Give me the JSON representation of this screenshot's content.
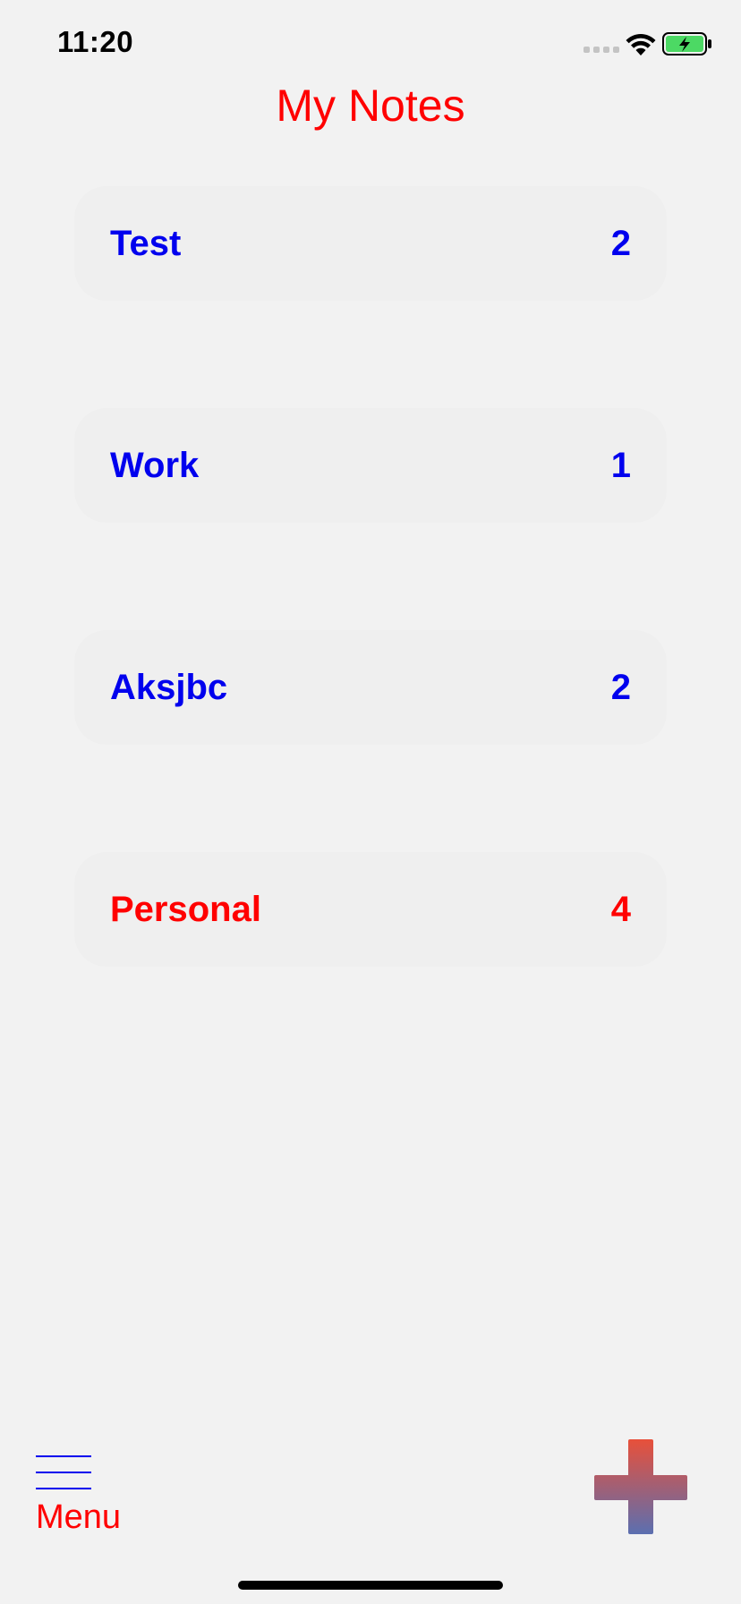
{
  "status_bar": {
    "time": "11:20",
    "icons": [
      "signal-icon",
      "wifi-icon",
      "battery-charging-icon"
    ]
  },
  "header": {
    "title": "My Notes"
  },
  "colors": {
    "title": "#ff0000",
    "item_default": "#0000ee",
    "item_selected": "#ff0000",
    "menu": "#ff0000",
    "card_background": "#efefef",
    "page_background": "#f2f2f2",
    "battery_green": "#4cd964",
    "add_gradient_top": "#e8503a",
    "add_gradient_bottom": "#5b6fb0"
  },
  "categories": [
    {
      "label": "Test",
      "count": "2",
      "selected": false
    },
    {
      "label": "Work",
      "count": "1",
      "selected": false
    },
    {
      "label": "Aksjbc",
      "count": "2",
      "selected": false
    },
    {
      "label": "Personal",
      "count": "4",
      "selected": true
    }
  ],
  "bottom_bar": {
    "menu_label": "Menu",
    "menu_icon": "hamburger-icon",
    "add_icon": "plus-icon"
  }
}
